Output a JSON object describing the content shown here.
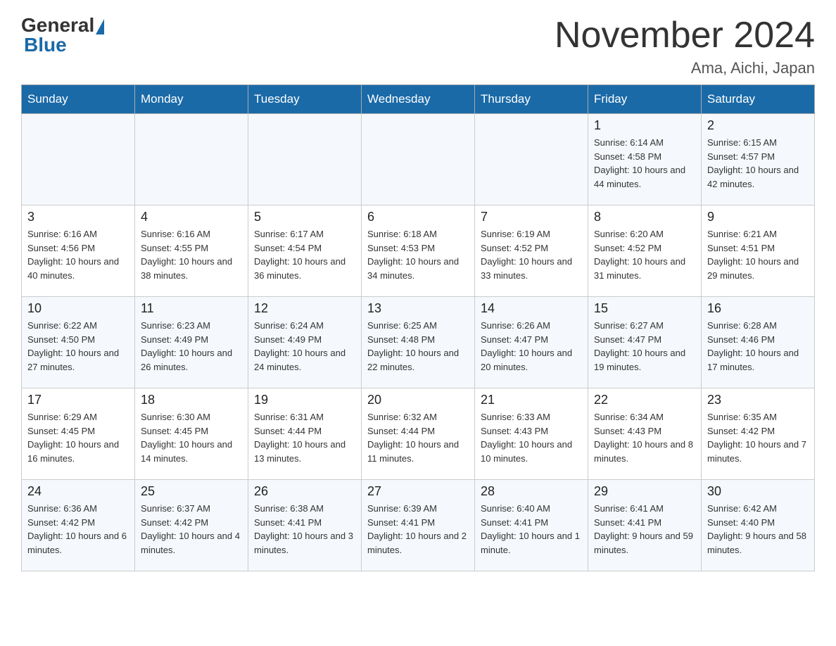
{
  "header": {
    "logo_general": "General",
    "logo_blue": "Blue",
    "month_title": "November 2024",
    "location": "Ama, Aichi, Japan"
  },
  "weekdays": [
    "Sunday",
    "Monday",
    "Tuesday",
    "Wednesday",
    "Thursday",
    "Friday",
    "Saturday"
  ],
  "weeks": [
    [
      {
        "day": "",
        "info": ""
      },
      {
        "day": "",
        "info": ""
      },
      {
        "day": "",
        "info": ""
      },
      {
        "day": "",
        "info": ""
      },
      {
        "day": "",
        "info": ""
      },
      {
        "day": "1",
        "info": "Sunrise: 6:14 AM\nSunset: 4:58 PM\nDaylight: 10 hours and 44 minutes."
      },
      {
        "day": "2",
        "info": "Sunrise: 6:15 AM\nSunset: 4:57 PM\nDaylight: 10 hours and 42 minutes."
      }
    ],
    [
      {
        "day": "3",
        "info": "Sunrise: 6:16 AM\nSunset: 4:56 PM\nDaylight: 10 hours and 40 minutes."
      },
      {
        "day": "4",
        "info": "Sunrise: 6:16 AM\nSunset: 4:55 PM\nDaylight: 10 hours and 38 minutes."
      },
      {
        "day": "5",
        "info": "Sunrise: 6:17 AM\nSunset: 4:54 PM\nDaylight: 10 hours and 36 minutes."
      },
      {
        "day": "6",
        "info": "Sunrise: 6:18 AM\nSunset: 4:53 PM\nDaylight: 10 hours and 34 minutes."
      },
      {
        "day": "7",
        "info": "Sunrise: 6:19 AM\nSunset: 4:52 PM\nDaylight: 10 hours and 33 minutes."
      },
      {
        "day": "8",
        "info": "Sunrise: 6:20 AM\nSunset: 4:52 PM\nDaylight: 10 hours and 31 minutes."
      },
      {
        "day": "9",
        "info": "Sunrise: 6:21 AM\nSunset: 4:51 PM\nDaylight: 10 hours and 29 minutes."
      }
    ],
    [
      {
        "day": "10",
        "info": "Sunrise: 6:22 AM\nSunset: 4:50 PM\nDaylight: 10 hours and 27 minutes."
      },
      {
        "day": "11",
        "info": "Sunrise: 6:23 AM\nSunset: 4:49 PM\nDaylight: 10 hours and 26 minutes."
      },
      {
        "day": "12",
        "info": "Sunrise: 6:24 AM\nSunset: 4:49 PM\nDaylight: 10 hours and 24 minutes."
      },
      {
        "day": "13",
        "info": "Sunrise: 6:25 AM\nSunset: 4:48 PM\nDaylight: 10 hours and 22 minutes."
      },
      {
        "day": "14",
        "info": "Sunrise: 6:26 AM\nSunset: 4:47 PM\nDaylight: 10 hours and 20 minutes."
      },
      {
        "day": "15",
        "info": "Sunrise: 6:27 AM\nSunset: 4:47 PM\nDaylight: 10 hours and 19 minutes."
      },
      {
        "day": "16",
        "info": "Sunrise: 6:28 AM\nSunset: 4:46 PM\nDaylight: 10 hours and 17 minutes."
      }
    ],
    [
      {
        "day": "17",
        "info": "Sunrise: 6:29 AM\nSunset: 4:45 PM\nDaylight: 10 hours and 16 minutes."
      },
      {
        "day": "18",
        "info": "Sunrise: 6:30 AM\nSunset: 4:45 PM\nDaylight: 10 hours and 14 minutes."
      },
      {
        "day": "19",
        "info": "Sunrise: 6:31 AM\nSunset: 4:44 PM\nDaylight: 10 hours and 13 minutes."
      },
      {
        "day": "20",
        "info": "Sunrise: 6:32 AM\nSunset: 4:44 PM\nDaylight: 10 hours and 11 minutes."
      },
      {
        "day": "21",
        "info": "Sunrise: 6:33 AM\nSunset: 4:43 PM\nDaylight: 10 hours and 10 minutes."
      },
      {
        "day": "22",
        "info": "Sunrise: 6:34 AM\nSunset: 4:43 PM\nDaylight: 10 hours and 8 minutes."
      },
      {
        "day": "23",
        "info": "Sunrise: 6:35 AM\nSunset: 4:42 PM\nDaylight: 10 hours and 7 minutes."
      }
    ],
    [
      {
        "day": "24",
        "info": "Sunrise: 6:36 AM\nSunset: 4:42 PM\nDaylight: 10 hours and 6 minutes."
      },
      {
        "day": "25",
        "info": "Sunrise: 6:37 AM\nSunset: 4:42 PM\nDaylight: 10 hours and 4 minutes."
      },
      {
        "day": "26",
        "info": "Sunrise: 6:38 AM\nSunset: 4:41 PM\nDaylight: 10 hours and 3 minutes."
      },
      {
        "day": "27",
        "info": "Sunrise: 6:39 AM\nSunset: 4:41 PM\nDaylight: 10 hours and 2 minutes."
      },
      {
        "day": "28",
        "info": "Sunrise: 6:40 AM\nSunset: 4:41 PM\nDaylight: 10 hours and 1 minute."
      },
      {
        "day": "29",
        "info": "Sunrise: 6:41 AM\nSunset: 4:41 PM\nDaylight: 9 hours and 59 minutes."
      },
      {
        "day": "30",
        "info": "Sunrise: 6:42 AM\nSunset: 4:40 PM\nDaylight: 9 hours and 58 minutes."
      }
    ]
  ]
}
